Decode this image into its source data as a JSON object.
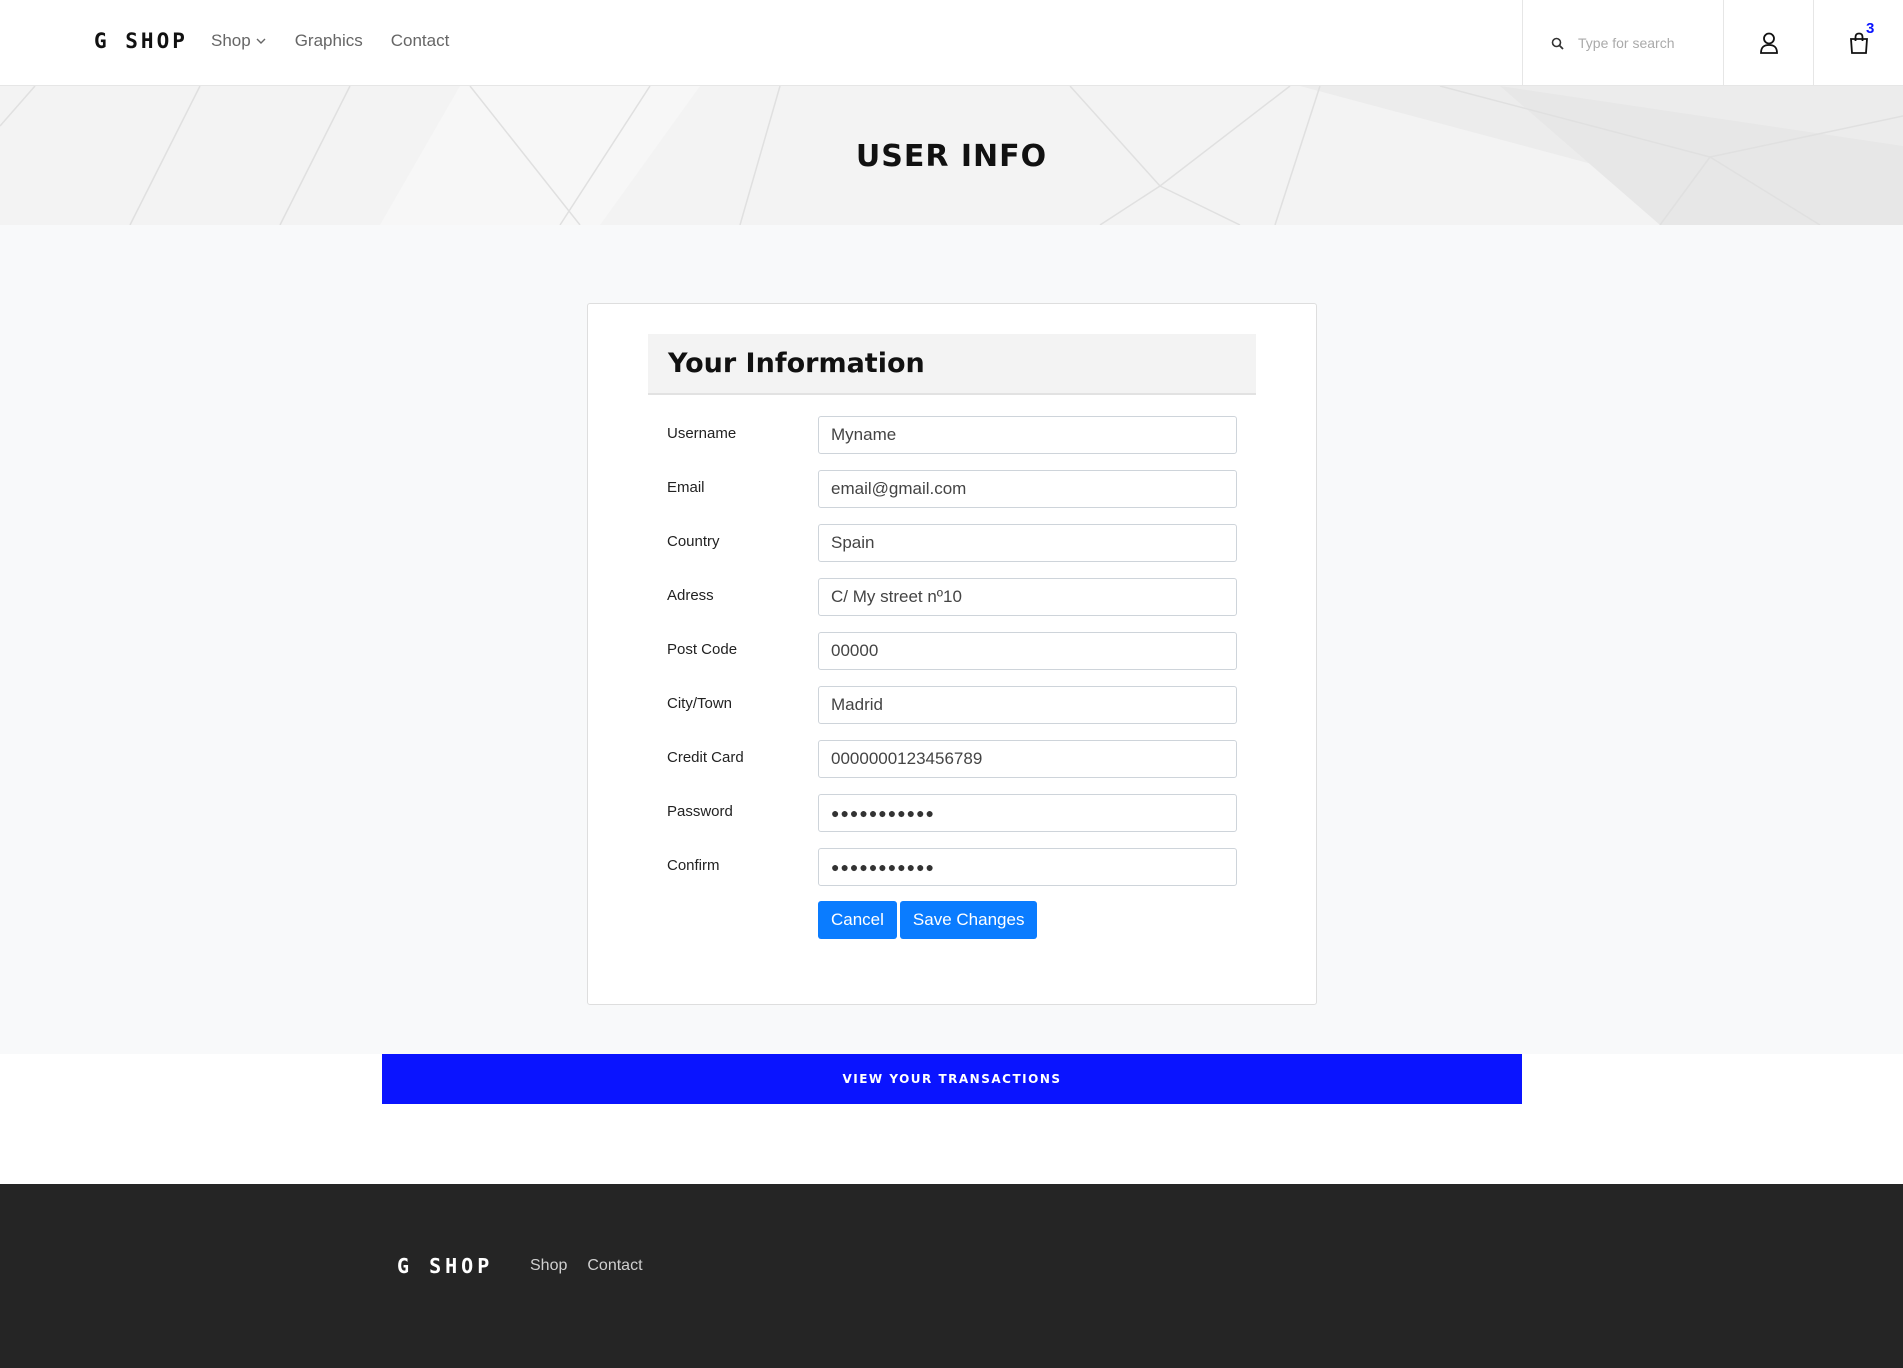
{
  "header": {
    "logo": "G SHOP",
    "nav": [
      {
        "label": "Shop",
        "has_dropdown": true
      },
      {
        "label": "Graphics"
      },
      {
        "label": "Contact"
      }
    ],
    "search_placeholder": "Type for search",
    "cart_count": "3",
    "icons": [
      "search-icon",
      "user-icon",
      "cart-icon",
      "chevron-down-icon"
    ]
  },
  "banner": {
    "title": "USER INFO"
  },
  "form": {
    "title": "Your Information",
    "fields": {
      "username": {
        "label": "Username",
        "value": "Myname"
      },
      "email": {
        "label": "Email",
        "value": "email@gmail.com"
      },
      "country": {
        "label": "Country",
        "value": "Spain"
      },
      "address": {
        "label": "Adress",
        "value": "C/ My street nº10"
      },
      "postcode": {
        "label": "Post Code",
        "value": "00000"
      },
      "city": {
        "label": "City/Town",
        "value": "Madrid"
      },
      "creditcard": {
        "label": "Credit Card",
        "value": "0000000123456789"
      },
      "password": {
        "label": "Password",
        "value": "●●●●●●●●●●●"
      },
      "confirm": {
        "label": "Confirm",
        "value": "●●●●●●●●●●●"
      }
    },
    "cancel_label": "Cancel",
    "save_label": "Save Changes"
  },
  "transactions": {
    "label": "VIEW YOUR TRANSACTIONS"
  },
  "footer": {
    "logo": "G SHOP",
    "links": [
      "Shop",
      "Contact"
    ]
  },
  "colors": {
    "accent_blue": "#0a14ff",
    "button_blue": "#0a7cff",
    "footer_bg": "#252525"
  }
}
